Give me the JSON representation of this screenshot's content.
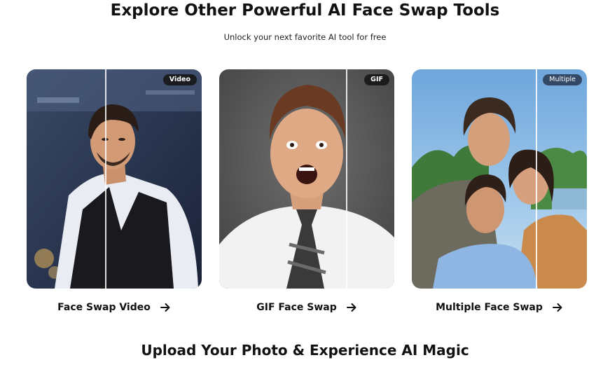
{
  "header": {
    "title": "Explore Other Powerful AI Face Swap Tools",
    "subtitle": "Unlock your next favorite AI tool for free"
  },
  "cards": [
    {
      "badge": "Video",
      "label": "Face Swap Video",
      "icon": "arrow-right-icon"
    },
    {
      "badge": "GIF",
      "label": "GIF Face Swap",
      "icon": "arrow-right-icon"
    },
    {
      "badge": "Multiple",
      "label": "Multiple Face Swap",
      "icon": "arrow-right-icon"
    }
  ],
  "footer": {
    "title": "Upload Your Photo & Experience AI Magic"
  },
  "colors": {
    "text": "#111111",
    "badge_bg": "#141414",
    "divider": "#ffffff"
  }
}
